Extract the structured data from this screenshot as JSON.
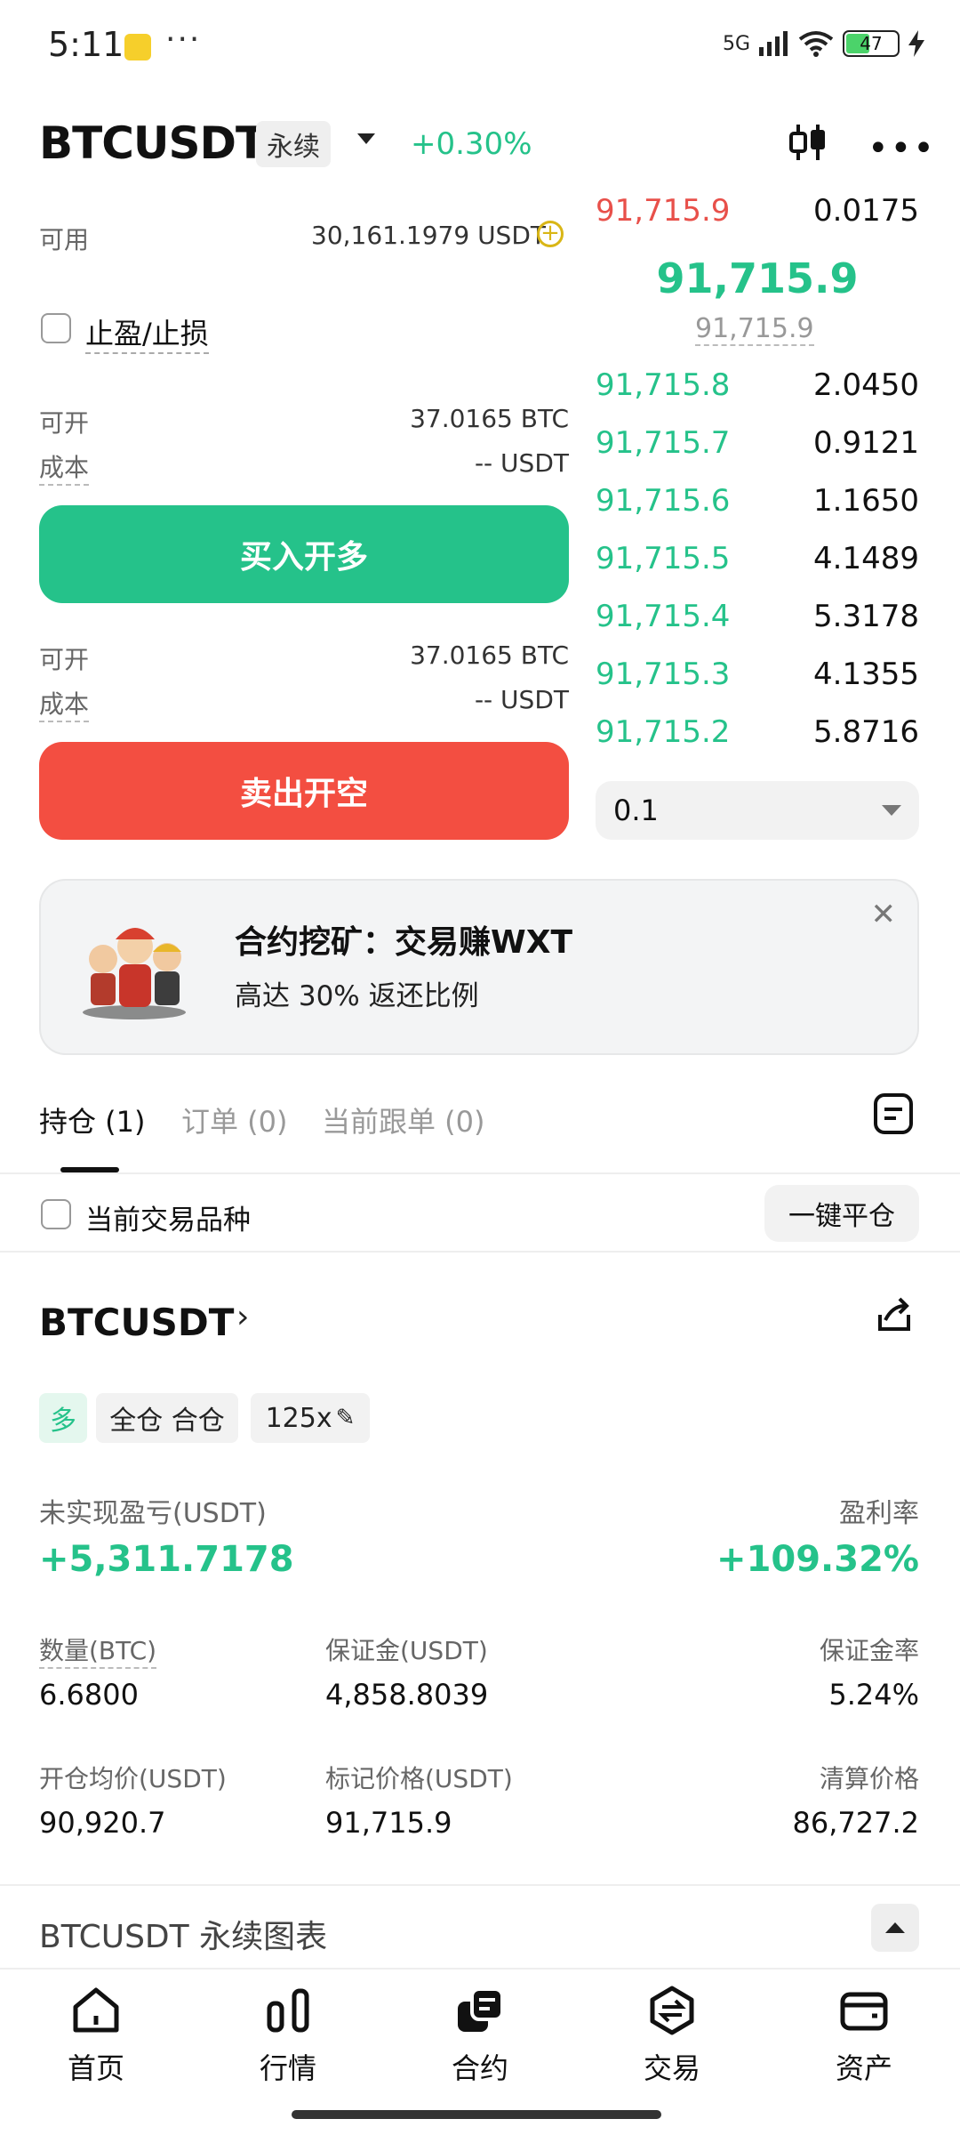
{
  "status_bar": {
    "time": "5:11",
    "dots": "···",
    "network": "5G",
    "battery": "47",
    "icons": [
      "app-notification-icon",
      "signal-icon",
      "wifi-icon",
      "battery-icon",
      "charging-icon"
    ]
  },
  "header": {
    "pair": "BTCUSDT",
    "contract_type": "永续",
    "change": "+0.30%",
    "icons": [
      "candlestick-icon",
      "more-icon"
    ]
  },
  "order_form": {
    "available_label": "可用",
    "available_value": "30,161.1979 USDT",
    "tpsl_label": "止盈/止损",
    "long": {
      "can_open_label": "可开",
      "can_open_value": "37.0165 BTC",
      "cost_label": "成本",
      "cost_value": "-- USDT",
      "button": "买入开多"
    },
    "short": {
      "can_open_label": "可开",
      "can_open_value": "37.0165 BTC",
      "cost_label": "成本",
      "cost_value": "-- USDT",
      "button": "卖出开空"
    }
  },
  "order_book": {
    "ask": {
      "price": "91,715.9",
      "amount": "0.0175"
    },
    "last_price": "91,715.9",
    "mark_price": "91,715.9",
    "bids": [
      {
        "price": "91,715.8",
        "amount": "2.0450",
        "depth": 1.0
      },
      {
        "price": "91,715.7",
        "amount": "0.9121",
        "depth": 0.61
      },
      {
        "price": "91,715.6",
        "amount": "1.1650",
        "depth": 0.61
      },
      {
        "price": "91,715.5",
        "amount": "4.1489",
        "depth": 0.61
      },
      {
        "price": "91,715.4",
        "amount": "5.3178",
        "depth": 0.61
      },
      {
        "price": "91,715.3",
        "amount": "4.1355",
        "depth": 0.61
      },
      {
        "price": "91,715.2",
        "amount": "5.8716",
        "depth": 0.61
      }
    ],
    "precision": "0.1"
  },
  "banner": {
    "title": "合约挖矿：交易赚WXT",
    "subtitle": "高达 30% 返还比例"
  },
  "tabs": [
    "持仓 (1)",
    "订单 (0)",
    "当前跟单 (0)"
  ],
  "filter": {
    "label": "当前交易品种",
    "close_all": "一键平仓"
  },
  "position": {
    "symbol": "BTCUSDT",
    "side": "多",
    "margin_mode": "全仓 合仓",
    "leverage": "125x",
    "pnl_label": "未实现盈亏(USDT)",
    "pnl_value": "+5,311.7178",
    "roi_label": "盈利率",
    "roi_value": "+109.32%",
    "qty_label": "数量(BTC)",
    "qty_value": "6.6800",
    "margin_label": "保证金(USDT)",
    "margin_value": "4,858.8039",
    "margin_ratio_label": "保证金率",
    "margin_ratio_value": "5.24%",
    "entry_label": "开仓均价(USDT)",
    "entry_value": "90,920.7",
    "mark_label": "标记价格(USDT)",
    "mark_value": "91,715.9",
    "liq_label": "清算价格",
    "liq_value": "86,727.2"
  },
  "chart_section": {
    "label": "BTCUSDT 永续图表"
  },
  "bottom_nav": [
    {
      "label": "首页",
      "icon": "home-icon"
    },
    {
      "label": "行情",
      "icon": "market-icon"
    },
    {
      "label": "合约",
      "icon": "futures-icon"
    },
    {
      "label": "交易",
      "icon": "trade-icon"
    },
    {
      "label": "资产",
      "icon": "wallet-icon"
    }
  ],
  "colors": {
    "green": "#25c28a",
    "red": "#f34e41",
    "ask_red": "#e8504a"
  }
}
